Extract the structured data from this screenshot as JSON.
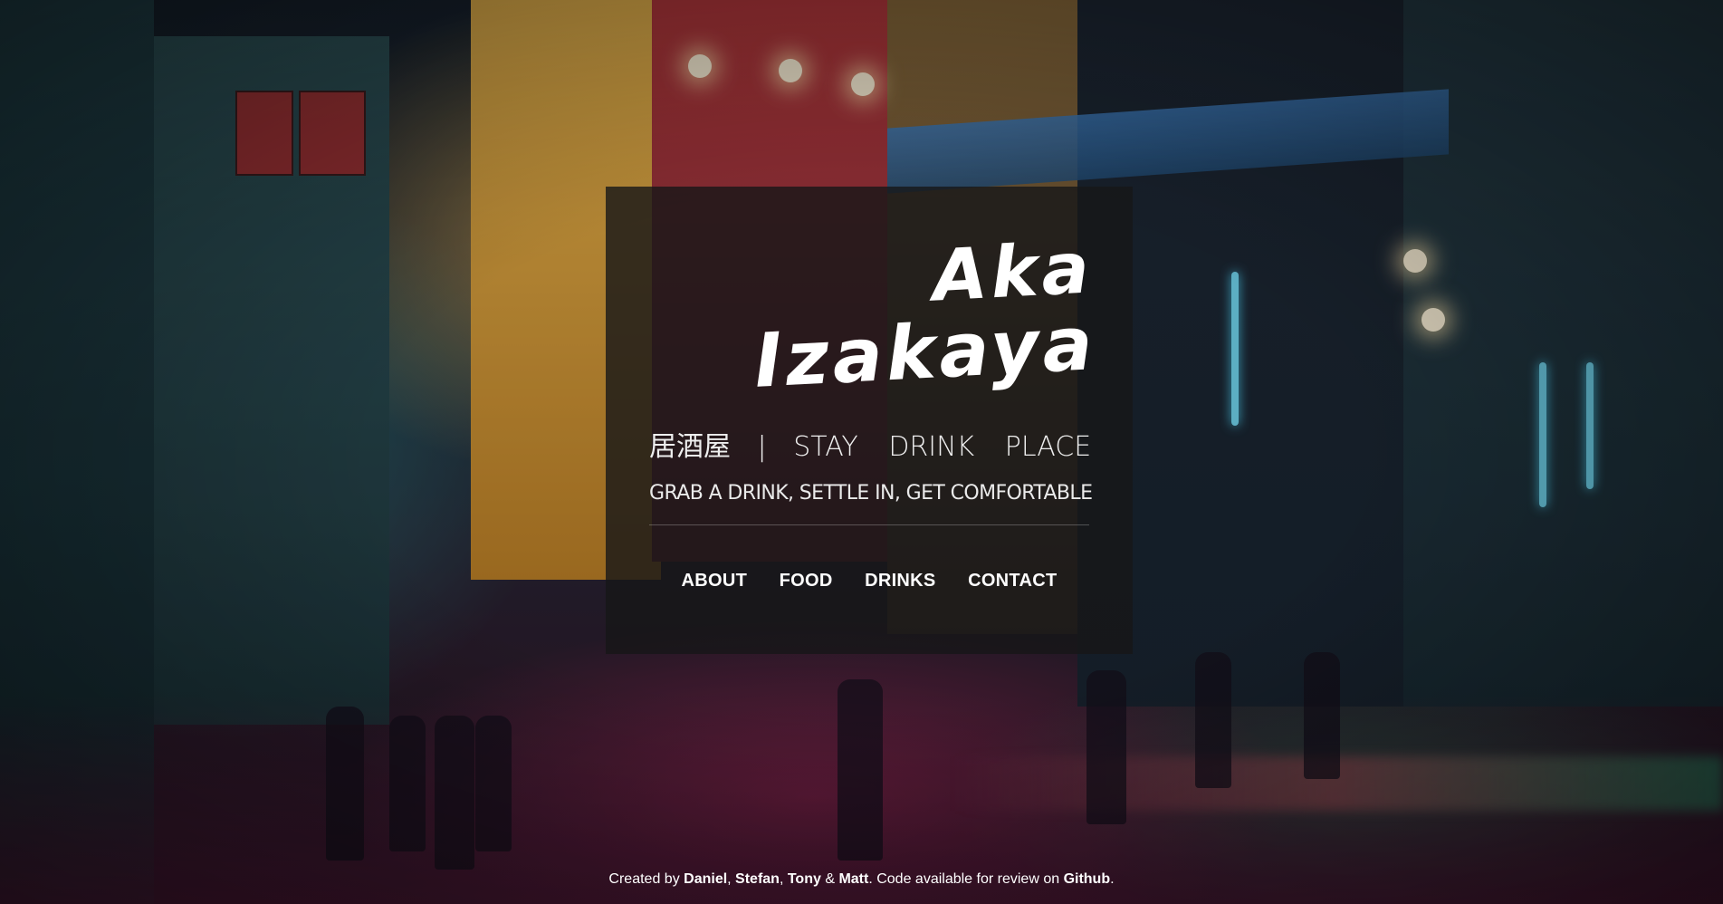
{
  "hero": {
    "title_line1": "Aka",
    "title_line2": "Izakaya",
    "tagline": {
      "kanji": "居酒屋",
      "separator": "|",
      "words": [
        "STAY",
        "DRINK",
        "PLACE"
      ]
    },
    "subtitle": "GRAB A DRINK, SETTLE IN, GET COMFORTABLE"
  },
  "nav": {
    "items": [
      "ABOUT",
      "FOOD",
      "DRINKS",
      "CONTACT"
    ]
  },
  "footer": {
    "prefix": "Created by ",
    "authors": [
      "Daniel",
      "Stefan",
      "Tony",
      "Matt"
    ],
    "comma": ", ",
    "amp": " & ",
    "middle": ". Code available for review on ",
    "link_label": "Github",
    "suffix": "."
  }
}
